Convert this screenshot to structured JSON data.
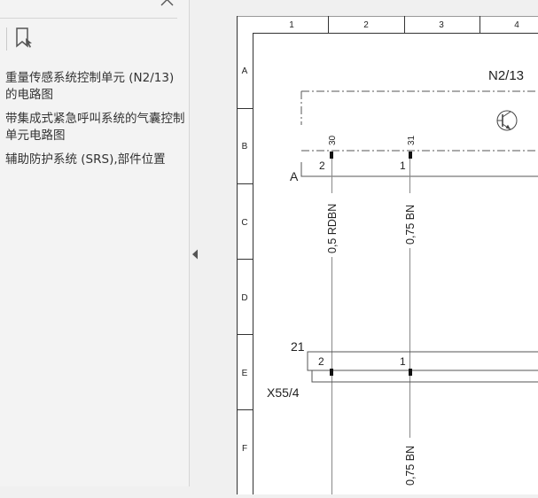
{
  "sidebar": {
    "outline": [
      "重量传感系统控制单元 (N2/13) 的电路图",
      "带集成式紧急呼叫系统的气囊控制单元电路图",
      "辅助防护系统 (SRS),部件位置"
    ]
  },
  "diagram": {
    "columns": [
      "1",
      "2",
      "3",
      "4"
    ],
    "rows": [
      "A",
      "B",
      "C",
      "D",
      "E",
      "F"
    ],
    "component_label": "N2/13",
    "connector_a_label": "A",
    "pin_left_label": "2",
    "pin_right_label": "1",
    "wire_left_top_number": "30",
    "wire_right_top_number": "31",
    "wire_left_label": "0,5 RDBN",
    "wire_right_label": "0,75 BN",
    "x55_number": "21",
    "x55_label": "X55/4",
    "x55_pin_left": "2",
    "x55_pin_right": "1",
    "wire_right_lower_label": "0,75 BN"
  },
  "icons": {
    "close": "close-icon",
    "bookmark": "bookmark-icon",
    "collapse": "triangle-left-icon",
    "transistor": "transistor-symbol"
  }
}
